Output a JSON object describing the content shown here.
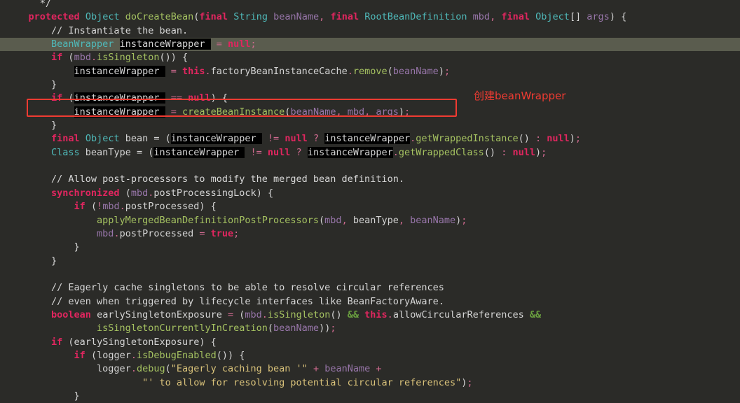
{
  "editor": {
    "theme_background": "#2b2b28",
    "current_line_background": "#5a5c4e",
    "occurrence_highlight_background": "#000000",
    "default_text_color": "#a9b7c6",
    "language": "Java"
  },
  "annotation": {
    "box_color": "#f03b32",
    "text": "创建beanWrapper",
    "text_color": "#f03b32"
  },
  "code": {
    "lines": [
      {
        "id": "l01",
        "current": false,
        "tokens": [
          {
            "t": "      ",
            "c": "pln"
          },
          {
            "t": "*/",
            "c": "cmt"
          }
        ]
      },
      {
        "id": "l02",
        "current": false,
        "tokens": [
          {
            "t": "    ",
            "c": "pln"
          },
          {
            "t": "protected",
            "c": "kw"
          },
          {
            "t": " ",
            "c": "pln"
          },
          {
            "t": "Object",
            "c": "typ"
          },
          {
            "t": " ",
            "c": "pln"
          },
          {
            "t": "doCreateBean",
            "c": "mth"
          },
          {
            "t": "(",
            "c": "punc"
          },
          {
            "t": "final",
            "c": "kw"
          },
          {
            "t": " ",
            "c": "pln"
          },
          {
            "t": "String",
            "c": "typ"
          },
          {
            "t": " ",
            "c": "pln"
          },
          {
            "t": "beanName",
            "c": "var"
          },
          {
            "t": ",",
            "c": "op"
          },
          {
            "t": " ",
            "c": "pln"
          },
          {
            "t": "final",
            "c": "kw"
          },
          {
            "t": " ",
            "c": "pln"
          },
          {
            "t": "RootBeanDefinition",
            "c": "typ"
          },
          {
            "t": " ",
            "c": "pln"
          },
          {
            "t": "mbd",
            "c": "var"
          },
          {
            "t": ",",
            "c": "op"
          },
          {
            "t": " ",
            "c": "pln"
          },
          {
            "t": "final",
            "c": "kw"
          },
          {
            "t": " ",
            "c": "pln"
          },
          {
            "t": "Object",
            "c": "typ"
          },
          {
            "t": "[] ",
            "c": "punc"
          },
          {
            "t": "args",
            "c": "var"
          },
          {
            "t": ")",
            "c": "punc"
          },
          {
            "t": " {",
            "c": "punc"
          }
        ]
      },
      {
        "id": "l03",
        "current": false,
        "tokens": [
          {
            "t": "        ",
            "c": "pln"
          },
          {
            "t": "// Instantiate the bean.",
            "c": "cmt"
          }
        ]
      },
      {
        "id": "l04",
        "current": true,
        "tokens": [
          {
            "t": "        ",
            "c": "pln"
          },
          {
            "t": "BeanWrapper",
            "c": "typ"
          },
          {
            "t": " ",
            "c": "pln"
          },
          {
            "t": "insta",
            "c": "occ"
          },
          {
            "t": "CARET",
            "c": "caret"
          },
          {
            "t": "nceWrapper ",
            "c": "occ"
          },
          {
            "t": " = ",
            "c": "op"
          },
          {
            "t": "null",
            "c": "kw"
          },
          {
            "t": ";",
            "c": "op"
          }
        ]
      },
      {
        "id": "l05",
        "current": false,
        "tokens": [
          {
            "t": "        ",
            "c": "pln"
          },
          {
            "t": "if",
            "c": "kw"
          },
          {
            "t": " (",
            "c": "punc"
          },
          {
            "t": "mbd",
            "c": "var"
          },
          {
            "t": ".",
            "c": "op"
          },
          {
            "t": "isSingleton",
            "c": "mth"
          },
          {
            "t": "()) {",
            "c": "punc"
          }
        ]
      },
      {
        "id": "l06",
        "current": false,
        "tokens": [
          {
            "t": "            ",
            "c": "pln"
          },
          {
            "t": "instanceWrapper ",
            "c": "occ"
          },
          {
            "t": " = ",
            "c": "op"
          },
          {
            "t": "this",
            "c": "kw"
          },
          {
            "t": ".",
            "c": "op"
          },
          {
            "t": "factoryBeanInstanceCache",
            "c": "pln"
          },
          {
            "t": ".",
            "c": "op"
          },
          {
            "t": "remove",
            "c": "mth"
          },
          {
            "t": "(",
            "c": "punc"
          },
          {
            "t": "beanName",
            "c": "var"
          },
          {
            "t": ")",
            "c": "punc"
          },
          {
            "t": ";",
            "c": "op"
          }
        ]
      },
      {
        "id": "l07",
        "current": false,
        "tokens": [
          {
            "t": "        }",
            "c": "punc"
          }
        ]
      },
      {
        "id": "l08",
        "current": false,
        "tokens": [
          {
            "t": "        ",
            "c": "pln"
          },
          {
            "t": "if",
            "c": "kw"
          },
          {
            "t": " (",
            "c": "punc"
          },
          {
            "t": "instanceWrapper ",
            "c": "occ"
          },
          {
            "t": " == ",
            "c": "op"
          },
          {
            "t": "null",
            "c": "kw"
          },
          {
            "t": ") {",
            "c": "punc"
          }
        ]
      },
      {
        "id": "l09",
        "current": false,
        "tokens": [
          {
            "t": "            ",
            "c": "pln"
          },
          {
            "t": "instanceWrapper ",
            "c": "occ"
          },
          {
            "t": " = ",
            "c": "op"
          },
          {
            "t": "createBeanInstance",
            "c": "mth"
          },
          {
            "t": "(",
            "c": "punc"
          },
          {
            "t": "beanName",
            "c": "var"
          },
          {
            "t": ", ",
            "c": "op"
          },
          {
            "t": "mbd",
            "c": "var"
          },
          {
            "t": ", ",
            "c": "op"
          },
          {
            "t": "args",
            "c": "var"
          },
          {
            "t": ")",
            "c": "punc"
          },
          {
            "t": ";",
            "c": "op"
          }
        ]
      },
      {
        "id": "l10",
        "current": false,
        "tokens": [
          {
            "t": "        }",
            "c": "punc"
          }
        ]
      },
      {
        "id": "l11",
        "current": false,
        "tokens": [
          {
            "t": "        ",
            "c": "pln"
          },
          {
            "t": "final",
            "c": "kw"
          },
          {
            "t": " ",
            "c": "pln"
          },
          {
            "t": "Object",
            "c": "typ"
          },
          {
            "t": " bean = (",
            "c": "punc"
          },
          {
            "t": "instanceWrapper ",
            "c": "occ"
          },
          {
            "t": " != ",
            "c": "op"
          },
          {
            "t": "null",
            "c": "kw"
          },
          {
            "t": " ? ",
            "c": "op"
          },
          {
            "t": "instanceWrapper",
            "c": "occ"
          },
          {
            "t": ".",
            "c": "op"
          },
          {
            "t": "getWrappedInstance",
            "c": "mth"
          },
          {
            "t": "()",
            "c": "punc"
          },
          {
            "t": " : ",
            "c": "op"
          },
          {
            "t": "null",
            "c": "kw"
          },
          {
            "t": ")",
            "c": "punc"
          },
          {
            "t": ";",
            "c": "op"
          }
        ]
      },
      {
        "id": "l12",
        "current": false,
        "tokens": [
          {
            "t": "        ",
            "c": "pln"
          },
          {
            "t": "Class",
            "c": "typ"
          },
          {
            "t": " beanType = (",
            "c": "punc"
          },
          {
            "t": "instanceWrapper ",
            "c": "occ"
          },
          {
            "t": " != ",
            "c": "op"
          },
          {
            "t": "null",
            "c": "kw"
          },
          {
            "t": " ? ",
            "c": "op"
          },
          {
            "t": "instanceWrapper",
            "c": "occ"
          },
          {
            "t": ".",
            "c": "op"
          },
          {
            "t": "getWrappedClass",
            "c": "mth"
          },
          {
            "t": "()",
            "c": "punc"
          },
          {
            "t": " : ",
            "c": "op"
          },
          {
            "t": "null",
            "c": "kw"
          },
          {
            "t": ")",
            "c": "punc"
          },
          {
            "t": ";",
            "c": "op"
          }
        ]
      },
      {
        "id": "l13",
        "current": false,
        "tokens": []
      },
      {
        "id": "l14",
        "current": false,
        "tokens": [
          {
            "t": "        ",
            "c": "pln"
          },
          {
            "t": "// Allow post-processors to modify the merged bean definition.",
            "c": "cmt"
          }
        ]
      },
      {
        "id": "l15",
        "current": false,
        "tokens": [
          {
            "t": "        ",
            "c": "pln"
          },
          {
            "t": "synchronized",
            "c": "kw"
          },
          {
            "t": " (",
            "c": "punc"
          },
          {
            "t": "mbd",
            "c": "var"
          },
          {
            "t": ".",
            "c": "op"
          },
          {
            "t": "postProcessingLock",
            "c": "pln"
          },
          {
            "t": ") {",
            "c": "punc"
          }
        ]
      },
      {
        "id": "l16",
        "current": false,
        "tokens": [
          {
            "t": "            ",
            "c": "pln"
          },
          {
            "t": "if",
            "c": "kw"
          },
          {
            "t": " (",
            "c": "punc"
          },
          {
            "t": "!",
            "c": "op"
          },
          {
            "t": "mbd",
            "c": "var"
          },
          {
            "t": ".",
            "c": "op"
          },
          {
            "t": "postProcessed",
            "c": "pln"
          },
          {
            "t": ") {",
            "c": "punc"
          }
        ]
      },
      {
        "id": "l17",
        "current": false,
        "tokens": [
          {
            "t": "                ",
            "c": "pln"
          },
          {
            "t": "applyMergedBeanDefinitionPostProcessors",
            "c": "mth"
          },
          {
            "t": "(",
            "c": "punc"
          },
          {
            "t": "mbd",
            "c": "var"
          },
          {
            "t": ", ",
            "c": "op"
          },
          {
            "t": "beanType",
            "c": "pln"
          },
          {
            "t": ", ",
            "c": "op"
          },
          {
            "t": "beanName",
            "c": "var"
          },
          {
            "t": ")",
            "c": "punc"
          },
          {
            "t": ";",
            "c": "op"
          }
        ]
      },
      {
        "id": "l18",
        "current": false,
        "tokens": [
          {
            "t": "                ",
            "c": "pln"
          },
          {
            "t": "mbd",
            "c": "var"
          },
          {
            "t": ".",
            "c": "op"
          },
          {
            "t": "postProcessed",
            "c": "pln"
          },
          {
            "t": " = ",
            "c": "op"
          },
          {
            "t": "true",
            "c": "kw"
          },
          {
            "t": ";",
            "c": "op"
          }
        ]
      },
      {
        "id": "l19",
        "current": false,
        "tokens": [
          {
            "t": "            }",
            "c": "punc"
          }
        ]
      },
      {
        "id": "l20",
        "current": false,
        "tokens": [
          {
            "t": "        }",
            "c": "punc"
          }
        ]
      },
      {
        "id": "l21",
        "current": false,
        "tokens": []
      },
      {
        "id": "l22",
        "current": false,
        "tokens": [
          {
            "t": "        ",
            "c": "pln"
          },
          {
            "t": "// Eagerly cache singletons to be able to resolve circular references",
            "c": "cmt"
          }
        ]
      },
      {
        "id": "l23",
        "current": false,
        "tokens": [
          {
            "t": "        ",
            "c": "pln"
          },
          {
            "t": "// even when triggered by lifecycle interfaces like BeanFactoryAware.",
            "c": "cmt"
          }
        ]
      },
      {
        "id": "l24",
        "current": false,
        "tokens": [
          {
            "t": "        ",
            "c": "pln"
          },
          {
            "t": "boolean",
            "c": "kw"
          },
          {
            "t": " earlySingletonExposure",
            "c": "pln"
          },
          {
            "t": " = ",
            "c": "op"
          },
          {
            "t": "(",
            "c": "punc"
          },
          {
            "t": "mbd",
            "c": "var"
          },
          {
            "t": ".",
            "c": "op"
          },
          {
            "t": "isSingleton",
            "c": "mth"
          },
          {
            "t": "()",
            "c": "punc"
          },
          {
            "t": " ",
            "c": "pln"
          },
          {
            "t": "&&",
            "c": "and"
          },
          {
            "t": " ",
            "c": "pln"
          },
          {
            "t": "this",
            "c": "kw"
          },
          {
            "t": ".",
            "c": "op"
          },
          {
            "t": "allowCircularReferences",
            "c": "pln"
          },
          {
            "t": " ",
            "c": "pln"
          },
          {
            "t": "&&",
            "c": "and"
          }
        ]
      },
      {
        "id": "l25",
        "current": false,
        "tokens": [
          {
            "t": "                ",
            "c": "pln"
          },
          {
            "t": "isSingletonCurrentlyInCreation",
            "c": "mth"
          },
          {
            "t": "(",
            "c": "punc"
          },
          {
            "t": "beanName",
            "c": "var"
          },
          {
            "t": "))",
            "c": "punc"
          },
          {
            "t": ";",
            "c": "op"
          }
        ]
      },
      {
        "id": "l26",
        "current": false,
        "tokens": [
          {
            "t": "        ",
            "c": "pln"
          },
          {
            "t": "if",
            "c": "kw"
          },
          {
            "t": " (earlySingletonExposure) {",
            "c": "punc"
          }
        ]
      },
      {
        "id": "l27",
        "current": false,
        "tokens": [
          {
            "t": "            ",
            "c": "pln"
          },
          {
            "t": "if",
            "c": "kw"
          },
          {
            "t": " (logger",
            "c": "punc"
          },
          {
            "t": ".",
            "c": "op"
          },
          {
            "t": "isDebugEnabled",
            "c": "mth"
          },
          {
            "t": "()) {",
            "c": "punc"
          }
        ]
      },
      {
        "id": "l28",
        "current": false,
        "tokens": [
          {
            "t": "                ",
            "c": "pln"
          },
          {
            "t": "logger",
            "c": "pln"
          },
          {
            "t": ".",
            "c": "op"
          },
          {
            "t": "debug",
            "c": "mth"
          },
          {
            "t": "(",
            "c": "punc"
          },
          {
            "t": "\"Eagerly caching bean '\"",
            "c": "str"
          },
          {
            "t": " + ",
            "c": "plus"
          },
          {
            "t": "beanName",
            "c": "var"
          },
          {
            "t": " +",
            "c": "plus"
          }
        ]
      },
      {
        "id": "l29",
        "current": false,
        "tokens": [
          {
            "t": "                        ",
            "c": "pln"
          },
          {
            "t": "\"' to allow for resolving potential circular references\"",
            "c": "str"
          },
          {
            "t": ")",
            "c": "punc"
          },
          {
            "t": ";",
            "c": "op"
          }
        ]
      },
      {
        "id": "l30",
        "current": false,
        "tokens": [
          {
            "t": "            }",
            "c": "punc"
          }
        ]
      }
    ]
  }
}
